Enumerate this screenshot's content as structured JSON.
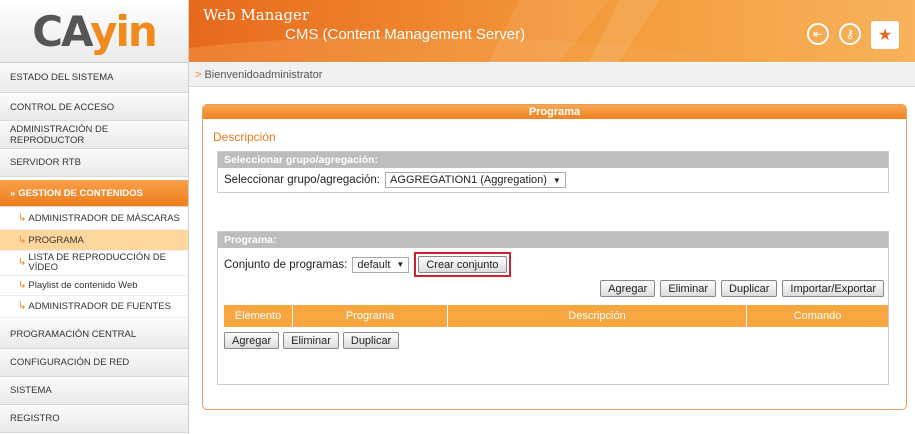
{
  "logo": {
    "text_a": "CA",
    "text_b": "yin"
  },
  "header": {
    "line1": "Web Manager",
    "line2": "CMS (Content Management Server)"
  },
  "header_icons": [
    "logout-icon",
    "key-icon",
    "network-icon"
  ],
  "sidebar": {
    "items": [
      {
        "label": "ESTADO DEL SISTEMA"
      },
      {
        "label": "CONTROL DE ACCESO"
      },
      {
        "label": "ADMINISTRACIÓN DE REPRODUCTOR"
      },
      {
        "label": "SERVIDOR RTB"
      },
      {
        "label": "GESTION DE CONTENIDOS"
      },
      {
        "label": "ADMINISTRADOR DE MÁSCARAS"
      },
      {
        "label": "PROGRAMA"
      },
      {
        "label": "LISTA DE REPRODUCCIÓN DE VÍDEO"
      },
      {
        "label": "Playlist de contenido Web"
      },
      {
        "label": "ADMINISTRADOR DE FUENTES"
      },
      {
        "label": "PROGRAMACIÓN CENTRAL"
      },
      {
        "label": "CONFIGURACIÓN DE RED"
      },
      {
        "label": "SISTEMA"
      },
      {
        "label": "REGISTRO"
      }
    ]
  },
  "breadcrumb": {
    "marker": ">",
    "text": "Bienvenidoadministrator"
  },
  "panel": {
    "title": "Programa",
    "description_link": "Descripción",
    "group": {
      "header": "Seleccionar grupo/agregación:",
      "label": "Seleccionar grupo/agregación:",
      "value": "AGGREGATION1 (Aggregation)"
    },
    "program": {
      "header": "Programa:",
      "set_label": "Conjunto de programas:",
      "set_value": "default",
      "create_set": "Crear conjunto",
      "top_buttons": [
        "Agregar",
        "Eliminar",
        "Duplicar",
        "Importar/Exportar"
      ],
      "columns": [
        "Elemento",
        "Programa",
        "Descripción",
        "Comando"
      ],
      "bottom_buttons": [
        "Agregar",
        "Eliminar",
        "Duplicar"
      ]
    }
  }
}
